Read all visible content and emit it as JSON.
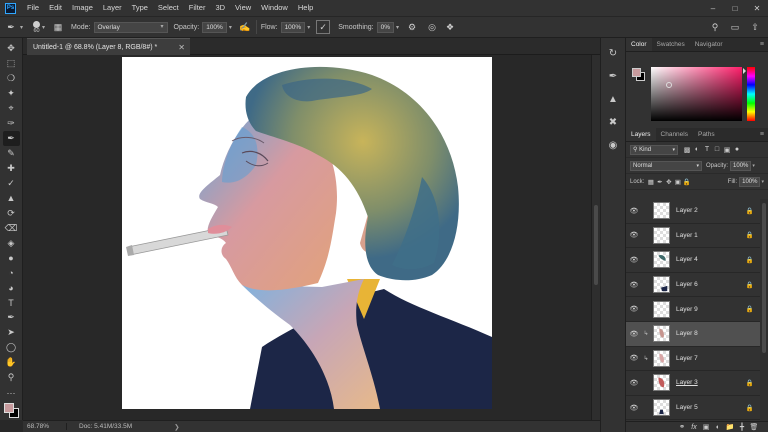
{
  "app": {
    "logo": "Ps"
  },
  "menu": [
    "File",
    "Edit",
    "Image",
    "Layer",
    "Type",
    "Select",
    "Filter",
    "3D",
    "View",
    "Window",
    "Help"
  ],
  "options": {
    "brush_size": "60",
    "mode_label": "Mode:",
    "mode_value": "Overlay",
    "opacity_label": "Opacity:",
    "opacity_value": "100%",
    "flow_label": "Flow:",
    "flow_value": "100%",
    "smoothing_label": "Smoothing:",
    "smoothing_value": "0%"
  },
  "document": {
    "tab_title": "Untitled-1 @ 68.8% (Layer 8, RGB/8#) *"
  },
  "status": {
    "zoom": "68.78%",
    "doc": "Doc: 5.41M/33.5M"
  },
  "colors": {
    "foreground": "#c79a9d",
    "background": "#000000",
    "accent": "#31a8ff"
  },
  "color_panel": {
    "tabs": [
      "Color",
      "Swatches",
      "Navigator"
    ]
  },
  "layers_panel": {
    "tabs": [
      "Layers",
      "Channels",
      "Paths"
    ],
    "kind": "Kind",
    "blend_mode": "Normal",
    "opacity_label": "Opacity:",
    "opacity_value": "100%",
    "lock_label": "Lock:",
    "fill_label": "Fill:",
    "fill_value": "100%",
    "layers": [
      {
        "name": "Layer 2",
        "clipped": false,
        "selected": false,
        "underline": false
      },
      {
        "name": "Layer 1",
        "clipped": false,
        "selected": false,
        "underline": false
      },
      {
        "name": "Layer 4",
        "clipped": false,
        "selected": false,
        "underline": false
      },
      {
        "name": "Layer 6",
        "clipped": false,
        "selected": false,
        "underline": false
      },
      {
        "name": "Layer 9",
        "clipped": false,
        "selected": false,
        "underline": false
      },
      {
        "name": "Layer 8",
        "clipped": true,
        "selected": true,
        "underline": false
      },
      {
        "name": "Layer 7",
        "clipped": true,
        "selected": false,
        "underline": false
      },
      {
        "name": "Layer 3",
        "clipped": false,
        "selected": false,
        "underline": true
      },
      {
        "name": "Layer 5",
        "clipped": false,
        "selected": false,
        "underline": false
      }
    ]
  }
}
